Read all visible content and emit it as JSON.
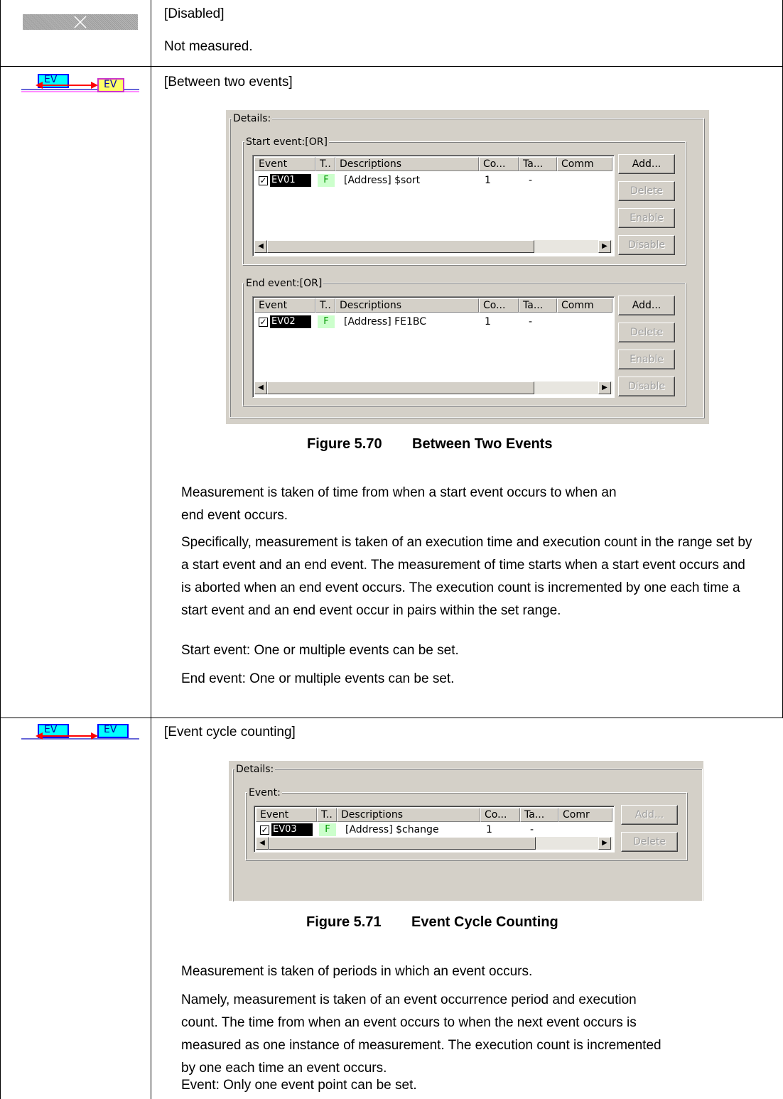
{
  "row1": {
    "heading": "[Disabled]",
    "text": "Not measured."
  },
  "row2": {
    "icon_label_1": "EV",
    "icon_label_2": "EV",
    "heading": "[Between two events]",
    "dialog": {
      "details_label": "Details:",
      "start_group_label": "Start event:[OR]",
      "end_group_label": "End event:[OR]",
      "columns": [
        "Event",
        "T..",
        "Descriptions",
        "Co...",
        "Ta...",
        "Comm"
      ],
      "start_row": {
        "event": "EV01",
        "type": "F",
        "description": "[Address] $sort",
        "count": "1",
        "target": "-"
      },
      "end_row": {
        "event": "EV02",
        "type": "F",
        "description": "[Address] FE1BC",
        "count": "1",
        "target": "-"
      },
      "buttons": {
        "add": "Add...",
        "delete": "Delete",
        "enable": "Enable",
        "disable": "Disable"
      }
    },
    "caption_num": "Figure 5.70",
    "caption_title": "Between Two Events",
    "paragraphs": [
      "Measurement is taken of time from when a start event occurs to when an end event occurs.",
      "Specifically, measurement is taken of an execution time and execution count in the range set by a start event and an end event. The measurement of time starts when a start event occurs and is aborted when an end event occurs. The execution count is incremented by one each time a start event and an end event occur in pairs within the set range.",
      "Start event: One or multiple events can be set.",
      "End event: One or multiple events can be set."
    ]
  },
  "row3": {
    "icon_label_1": "EV",
    "icon_label_2": "EV",
    "heading": "[Event cycle counting]",
    "dialog": {
      "details_label": "Details:",
      "group_label": "Event:",
      "columns": [
        "Event",
        "T..",
        "Descriptions",
        "Co...",
        "Ta...",
        "Comr"
      ],
      "row": {
        "event": "EV03",
        "type": "F",
        "description": "[Address] $change",
        "count": "1",
        "target": "-"
      },
      "buttons": {
        "add": "Add...",
        "delete": "Delete"
      }
    },
    "caption_num": "Figure 5.71",
    "caption_title": "Event Cycle Counting",
    "paragraphs": [
      "Measurement is taken of periods in which an event occurs.",
      "Namely, measurement is taken of an event occurrence period and execution count. The time from when an event occurs to when the next event occurs is measured as one instance of measurement. The execution count is incremented by one each time an event occurs.",
      "Event: Only one event point can be set."
    ]
  }
}
